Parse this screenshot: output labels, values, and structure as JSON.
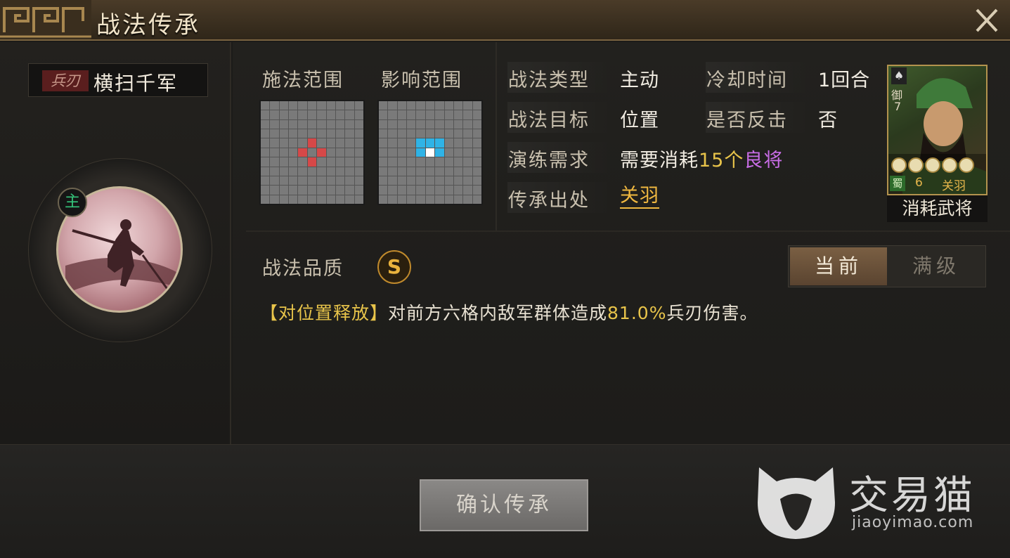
{
  "window": {
    "title": "战法传承"
  },
  "skill": {
    "damage_type": "兵刃",
    "name": "横扫千军",
    "main_badge": "主"
  },
  "ranges": {
    "cast_label": "施法范围",
    "effect_label": "影响范围",
    "cast_cells_color": "#d64848",
    "effect_cells_color": "#2fb3e6",
    "center_color": "#ffffff"
  },
  "info": {
    "type_label": "战法类型",
    "type_value": "主动",
    "cooldown_label": "冷却时间",
    "cooldown_value": "1回合",
    "target_label": "战法目标",
    "target_value": "位置",
    "counter_label": "是否反击",
    "counter_value": "否",
    "practice_label": "演练需求",
    "practice_prefix": "需要消耗",
    "practice_count": "15个",
    "practice_item": "良将",
    "source_label": "传承出处",
    "source_value": "关羽"
  },
  "hero_card": {
    "role": "御",
    "cost": "7",
    "faction": "蜀",
    "level": "6",
    "name": "关羽",
    "stars": 5,
    "consume_label": "消耗武将"
  },
  "quality": {
    "label": "战法品质",
    "grade": "S"
  },
  "level_toggle": {
    "current": "当前",
    "max": "满级"
  },
  "description": {
    "tag": "【对位置释放】",
    "text_before": "对前方六格内敌军群体造成",
    "value": "81.0%",
    "text_after": "兵刃伤害。"
  },
  "actions": {
    "confirm": "确认传承"
  },
  "watermark": {
    "brand": "交易猫",
    "url": "jiaoyimao.com"
  }
}
